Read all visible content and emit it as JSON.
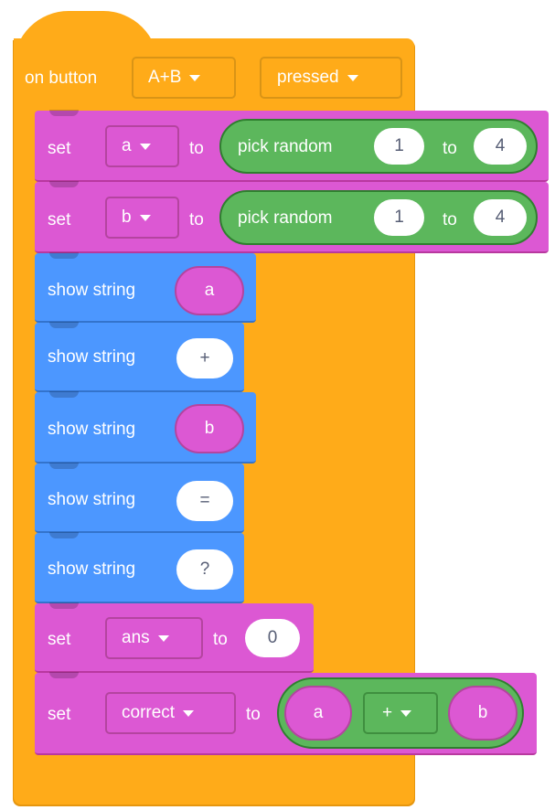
{
  "event": {
    "prefix": "on button",
    "button_value": "A+B",
    "action_value": "pressed"
  },
  "blocks": [
    {
      "kind": "set",
      "keyword": "set",
      "variable": "a",
      "to": "to",
      "expr": {
        "label": "pick random",
        "from": "1",
        "to_label": "to",
        "to": "4"
      }
    },
    {
      "kind": "set",
      "keyword": "set",
      "variable": "b",
      "to": "to",
      "expr": {
        "label": "pick random",
        "from": "1",
        "to_label": "to",
        "to": "4"
      }
    },
    {
      "kind": "show",
      "label": "show string",
      "arg": "a",
      "arg_is_var": true
    },
    {
      "kind": "show",
      "label": "show string",
      "arg": "+",
      "arg_is_var": false
    },
    {
      "kind": "show",
      "label": "show string",
      "arg": "b",
      "arg_is_var": true
    },
    {
      "kind": "show",
      "label": "show string",
      "arg": "=",
      "arg_is_var": false
    },
    {
      "kind": "show",
      "label": "show string",
      "arg": "?",
      "arg_is_var": false
    },
    {
      "kind": "set",
      "keyword": "set",
      "variable": "ans",
      "to": "to",
      "value": "0"
    },
    {
      "kind": "set",
      "keyword": "set",
      "variable": "correct",
      "to": "to",
      "math": {
        "left": "a",
        "op": "+",
        "right": "b"
      }
    }
  ],
  "colors": {
    "events": "#ffab19",
    "variables": "#dc58d3",
    "basic": "#4c97ff",
    "math": "#5cb75c"
  }
}
